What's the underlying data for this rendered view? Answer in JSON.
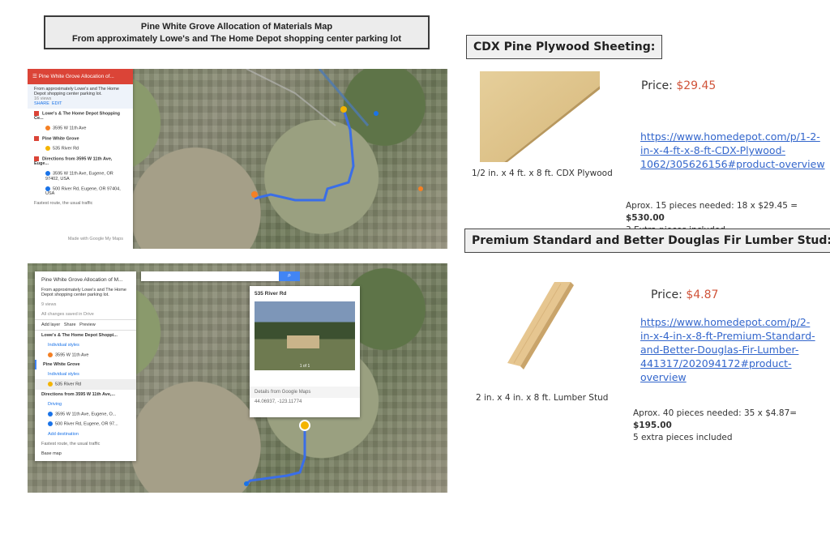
{
  "title": {
    "line1": "Pine White Grove Allocation of Materials Map",
    "line2": "From approximately Lowe's and The Home Depot shopping center parking lot"
  },
  "map1": {
    "header": "Pine White Grove Allocation of...",
    "description": "From approximately Lowe's and The Home Depot shopping center parking lot.",
    "views": "16 views",
    "share": "SHARE",
    "edit": "EDIT",
    "layer1": "Lowe's & The Home Depot Shopping Ce...",
    "layer1_item": "3595 W 11th Ave",
    "layer2": "Pine White Grove",
    "layer2_item": "535 River Rd",
    "layer3": "Directions from 3595 W 11th Ave, Euge...",
    "layer3_a": "3595 W 11th Ave, Eugene, OR 97402, USA",
    "layer3_b": "500 River Rd, Eugene, OR 97404, USA",
    "traffic": "Fastest route, the usual traffic",
    "footer": "Made with Google My Maps"
  },
  "map2": {
    "header": "Pine White Grove Allocation of M...",
    "description": "From approximately Lowe's and The Home Depot shopping center parking lot.",
    "views": "9 views",
    "saved": "All changes saved in Drive",
    "add_layer": "Add layer",
    "share": "Share",
    "preview": "Preview",
    "layer1": "Lowe's & The Home Depot Shoppi...",
    "individual": "Individual styles",
    "layer1_item": "3595 W 11th Ave",
    "layer2": "Pine White Grove",
    "layer2_item": "535 River Rd",
    "layer3": "Directions from 3595 W 11th Ave,...",
    "driving": "Driving",
    "layer3_a": "3595 W 11th Ave, Eugene, O...",
    "layer3_b": "500 River Rd, Eugene, OR 97...",
    "add_destination": "Add destination",
    "traffic": "Fastest route, the usual traffic",
    "base_map": "Base map",
    "popup_title": "535 River Rd",
    "popup_count": "1 of 1",
    "popup_details": "Details from Google Maps",
    "popup_coords": "44.06937, -123.11774"
  },
  "product1": {
    "heading": "CDX Pine Plywood Sheeting:",
    "price_label": "Price:",
    "price": "$29.45",
    "url_lines": [
      "https://www.homedepot.com/p/1-2-",
      "in-x-4-ft-x-8-ft-CDX-Plywood-",
      "1062/305626156#product-overview"
    ],
    "caption": "1/2 in. x 4 ft. x 8 ft. CDX Plywood",
    "calc_text": "Aprox. 15 pieces needed: 18 x $29.45 = ",
    "calc_total": "$530.00",
    "extra": "3 Extra pieces included"
  },
  "product2": {
    "heading": "Premium Standard and Better Douglas Fir Lumber Stud:",
    "price_label": "Price:",
    "price": "$4.87",
    "url_lines": [
      "https://www.homedepot.com/p/2-",
      "in-x-4-in-x-8-ft-Premium-Standard-",
      "and-Better-Douglas-Fir-Lumber-",
      "441317/202094172#product-",
      "overview"
    ],
    "caption": "2 in. x 4 in. x 8 ft. Lumber Stud",
    "calc_text": "Aprox. 40 pieces needed: 35 x $4.87= ",
    "calc_total": "$195.00",
    "extra": "5 extra pieces included"
  },
  "colors": {
    "price": "#d0543a",
    "link": "#3366cc",
    "route": "#3a6ee8",
    "map_red": "#db4437"
  }
}
